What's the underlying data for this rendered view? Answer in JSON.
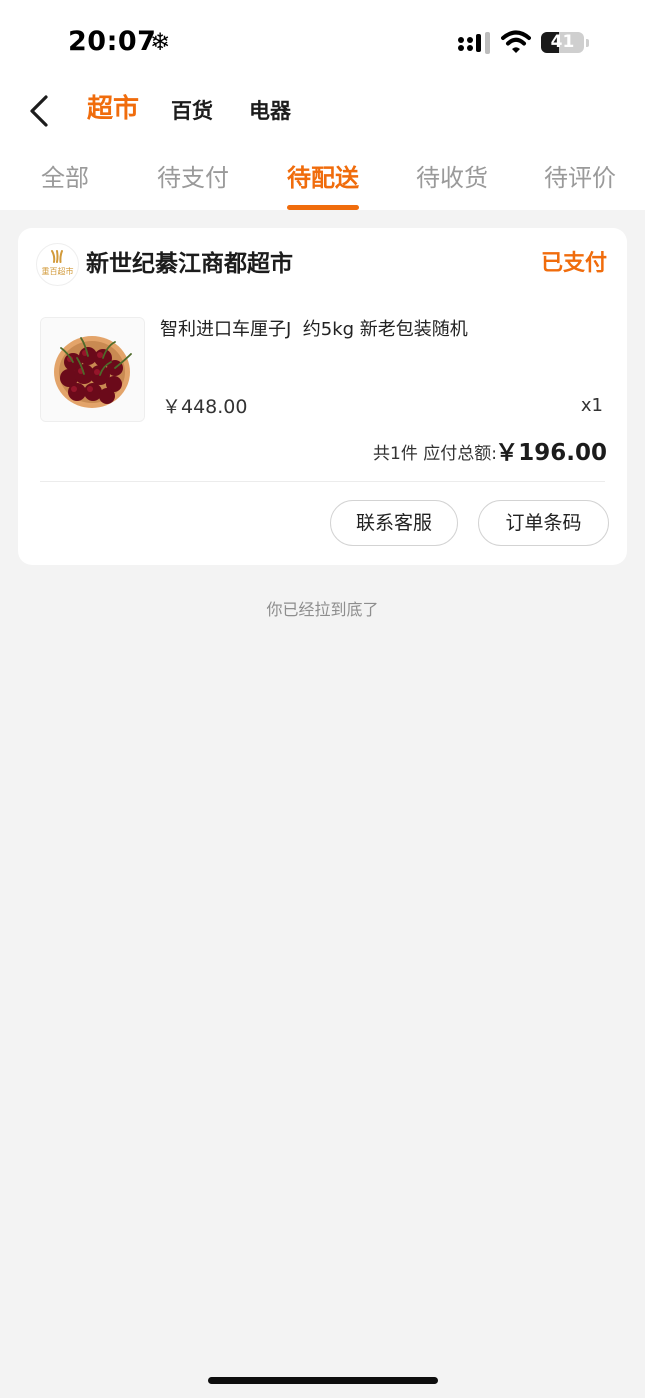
{
  "status_bar": {
    "time": "20:07",
    "extra_glyph": "❄",
    "battery_level": "41",
    "battery_fraction": 0.41
  },
  "nav": {
    "back_icon": "chevron-left-icon",
    "categories": [
      "超市",
      "百货",
      "电器"
    ],
    "active_category": "超市"
  },
  "tabs": {
    "items": [
      "全部",
      "待支付",
      "待配送",
      "待收货",
      "待评价"
    ],
    "active": "待配送"
  },
  "order": {
    "shop_logo_text": "重百超市",
    "shop_name": "新世纪綦江商都超市",
    "status": "已支付",
    "product": {
      "title": "智利进口车厘子J  约5kg 新老包装随机",
      "price": "￥448.00",
      "quantity": "x1"
    },
    "summary_label": "共1件 应付总额:",
    "summary_total": "￥196.00",
    "actions": {
      "contact": "联系客服",
      "barcode": "订单条码"
    }
  },
  "footer": {
    "end_text": "你已经拉到底了"
  },
  "colors": {
    "accent": "#f06c0c",
    "background": "#f3f3f3"
  }
}
